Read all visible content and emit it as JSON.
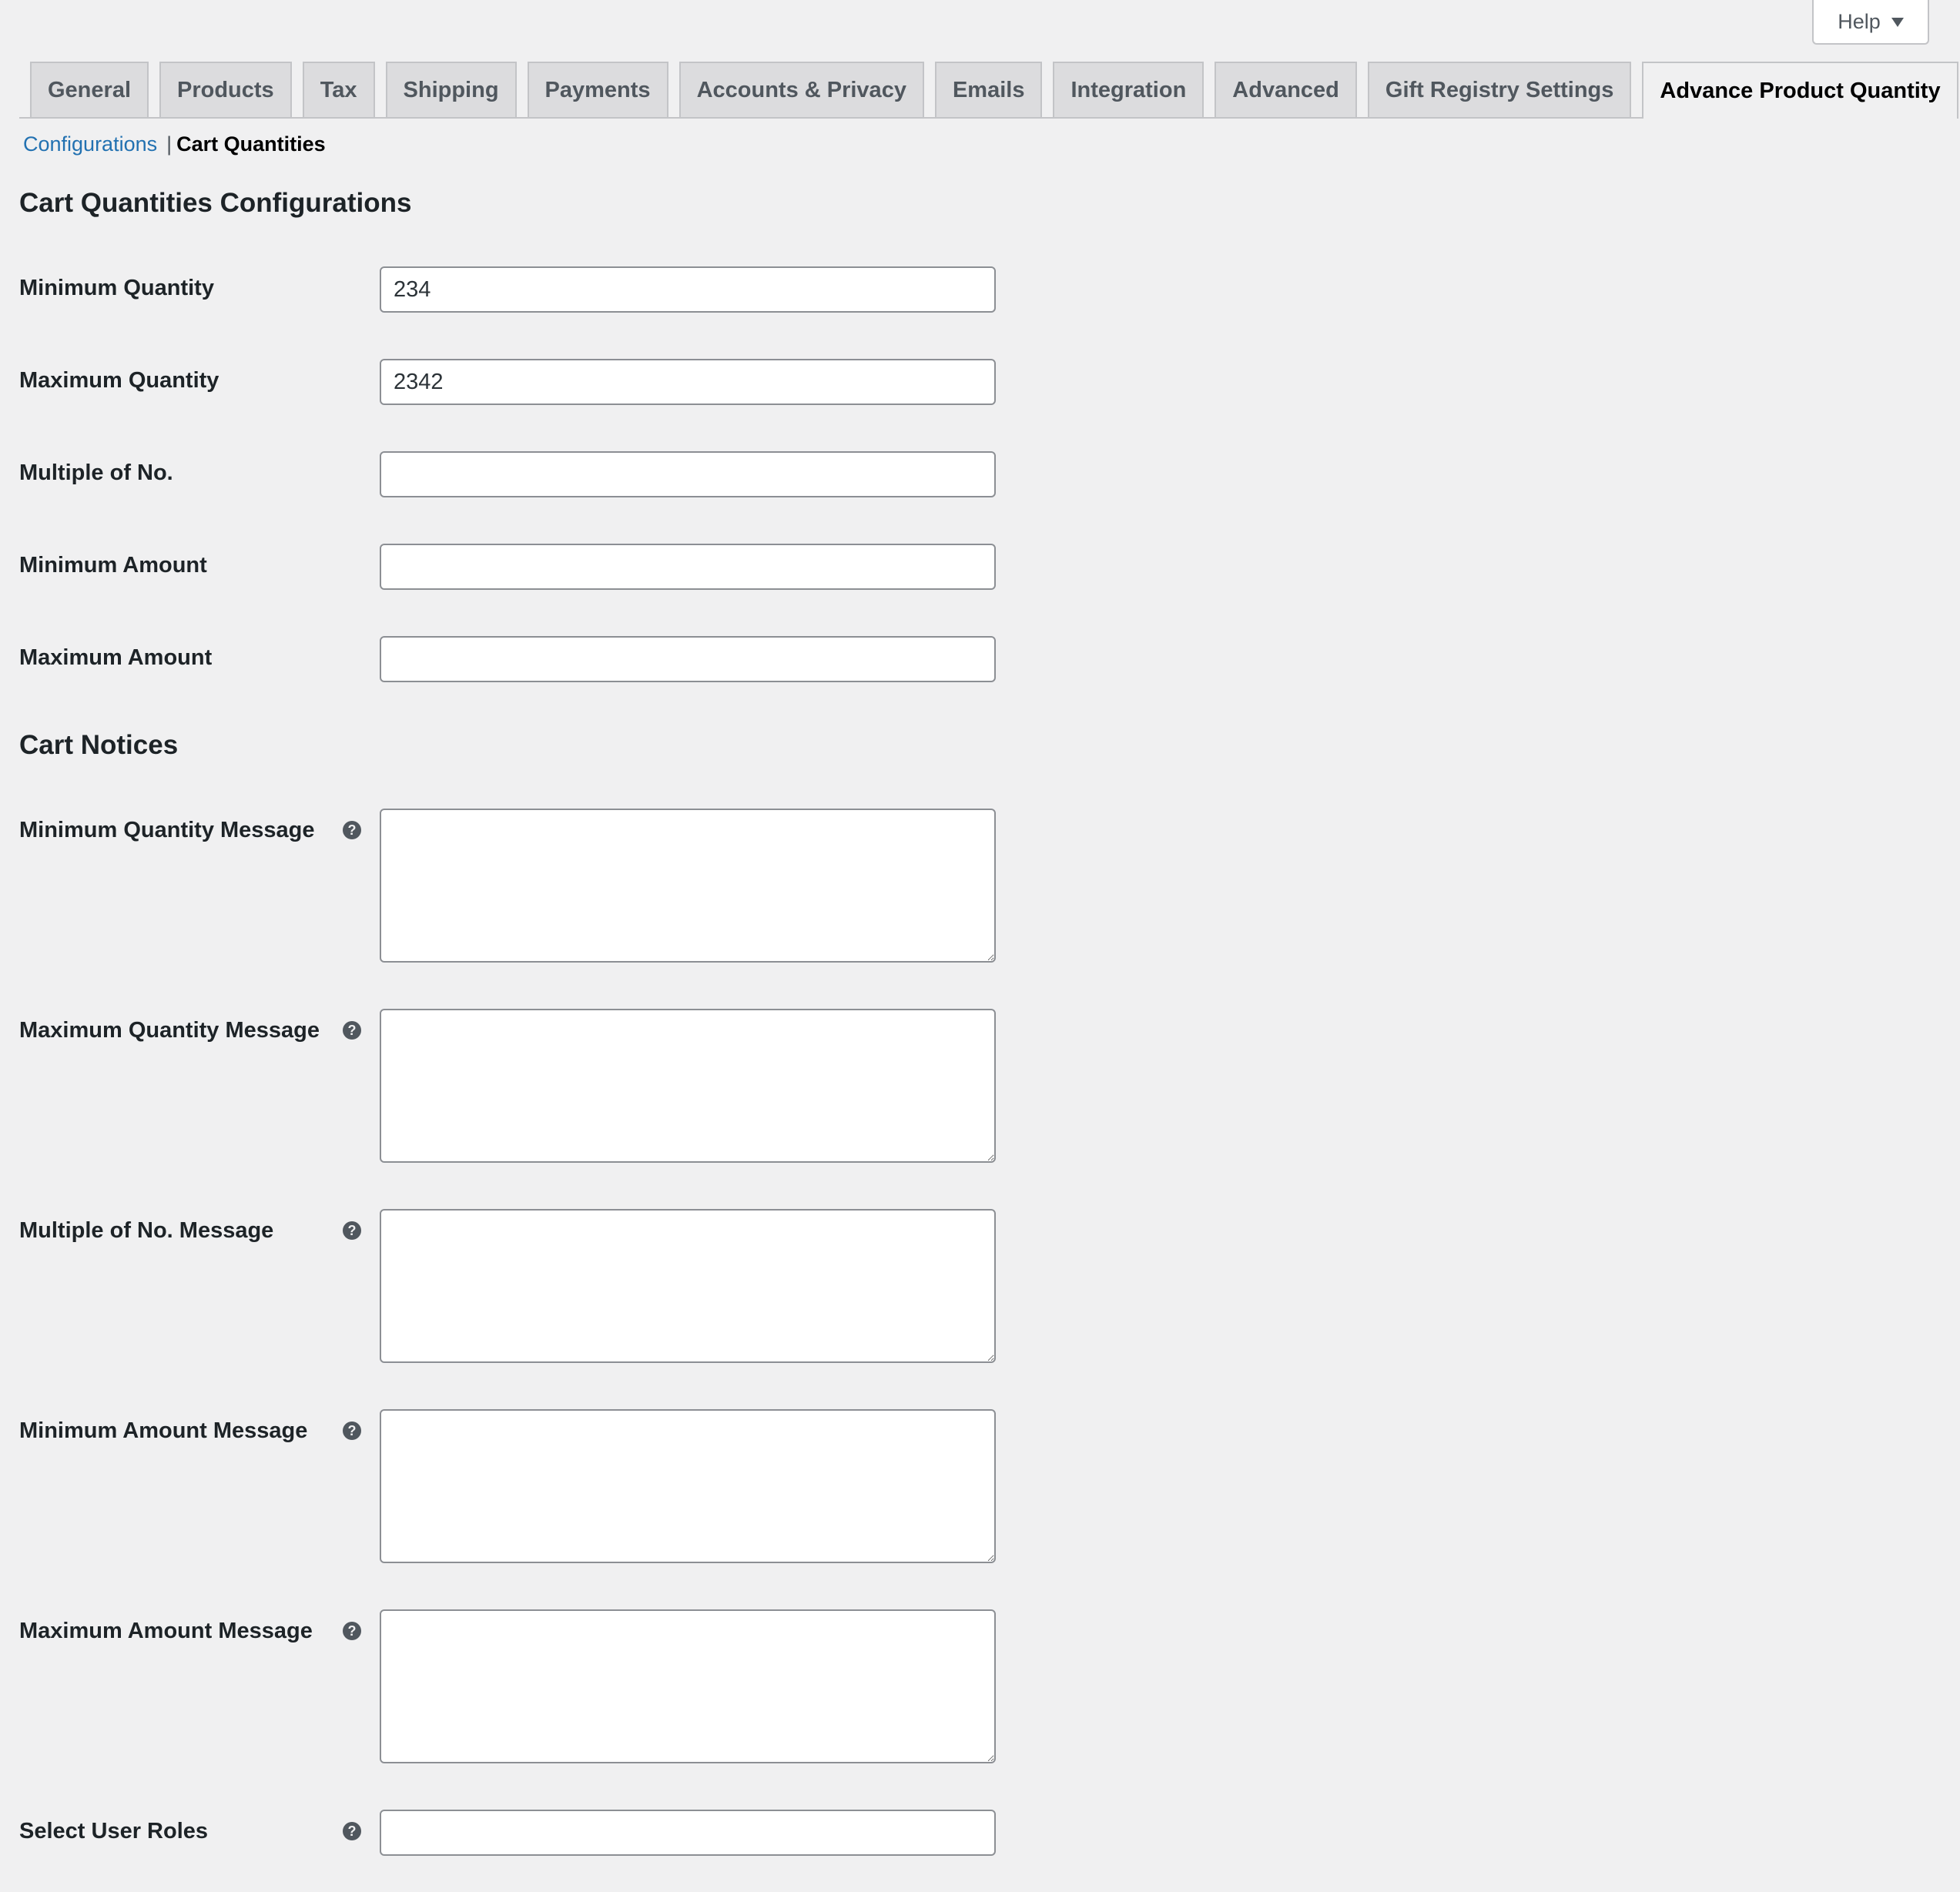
{
  "help": {
    "label": "Help"
  },
  "tabs": [
    {
      "label": "General"
    },
    {
      "label": "Products"
    },
    {
      "label": "Tax"
    },
    {
      "label": "Shipping"
    },
    {
      "label": "Payments"
    },
    {
      "label": "Accounts & Privacy"
    },
    {
      "label": "Emails"
    },
    {
      "label": "Integration"
    },
    {
      "label": "Advanced"
    },
    {
      "label": "Gift Registry Settings"
    },
    {
      "label": "Advance Product Quantity",
      "active": true
    }
  ],
  "subnav": {
    "link": "Configurations",
    "separator": "|",
    "current": "Cart Quantities"
  },
  "section_config": {
    "title": "Cart Quantities Configurations",
    "fields": [
      {
        "label": "Minimum Quantity",
        "value": "234"
      },
      {
        "label": "Maximum Quantity",
        "value": "2342"
      },
      {
        "label": "Multiple of No.",
        "value": ""
      },
      {
        "label": "Minimum Amount",
        "value": ""
      },
      {
        "label": "Maximum Amount",
        "value": ""
      }
    ]
  },
  "section_notices": {
    "title": "Cart Notices",
    "fields": [
      {
        "label": "Minimum Quantity Message",
        "value": ""
      },
      {
        "label": "Maximum Quantity Message",
        "value": ""
      },
      {
        "label": "Multiple of No. Message",
        "value": ""
      },
      {
        "label": "Minimum Amount Message",
        "value": ""
      },
      {
        "label": "Maximum Amount Message",
        "value": ""
      }
    ],
    "user_roles": {
      "label": "Select User Roles",
      "value": ""
    }
  },
  "help_icon_glyph": "?",
  "colors": {
    "link": "#2271b1",
    "background": "#f0f0f1",
    "tab_inactive": "#dcdcde"
  }
}
